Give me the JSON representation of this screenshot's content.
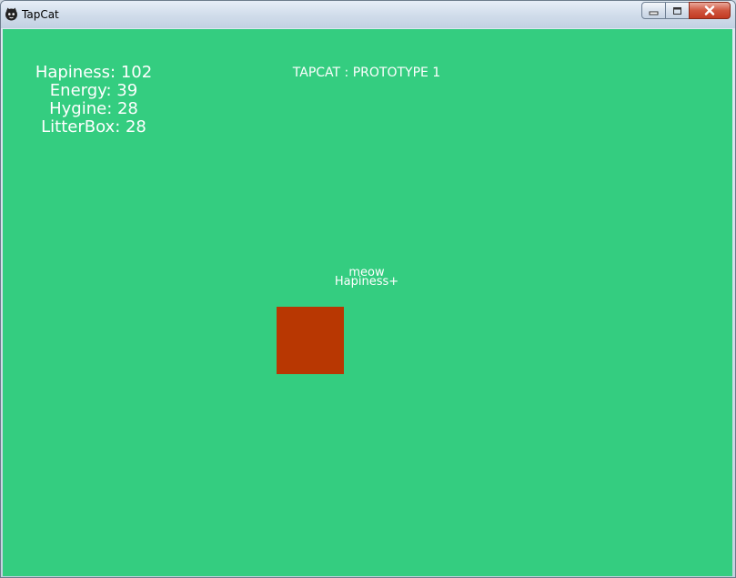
{
  "window": {
    "title": "TapCat",
    "controls": {
      "minimize_icon": "minimize-icon",
      "maximize_icon": "maximize-icon",
      "close_icon": "close-icon"
    }
  },
  "game": {
    "background_color": "#34cd80",
    "title": "TAPCAT : PROTOTYPE 1",
    "stats": {
      "happiness": "Hapiness: 102",
      "energy": "Energy: 39",
      "hygiene": "Hygine: 28",
      "litterbox": "LitterBox: 28"
    },
    "speech": {
      "line1": "meow",
      "line2": "Hapiness+"
    },
    "cat": {
      "color": "#b83702"
    }
  }
}
